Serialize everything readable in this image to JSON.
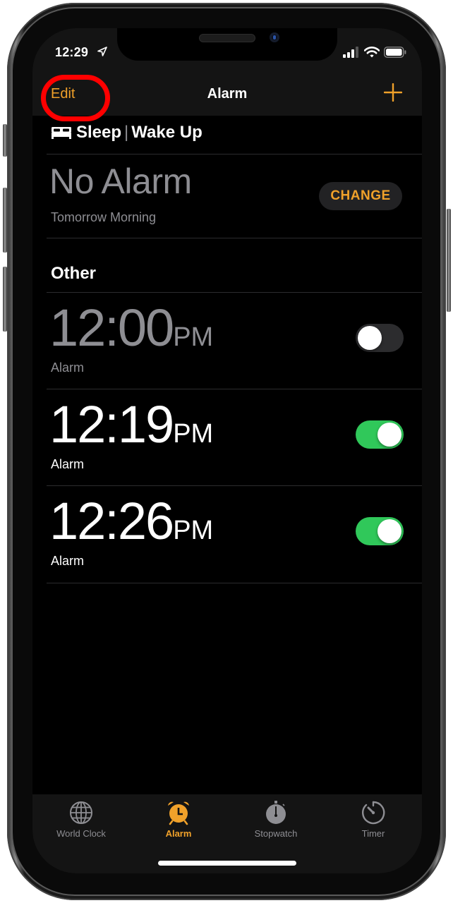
{
  "status_bar": {
    "time": "12:29",
    "icons": [
      "location-arrow-icon",
      "cellular-signal-icon",
      "wifi-icon",
      "battery-icon"
    ]
  },
  "nav": {
    "edit_label": "Edit",
    "title": "Alarm",
    "add_icon": "plus-icon",
    "highlight_color": "#ff0000"
  },
  "sleep_section": {
    "icon": "bed-icon",
    "title_left": "Sleep",
    "separator": "|",
    "title_right": "Wake Up",
    "alarm_text": "No Alarm",
    "subtitle": "Tomorrow Morning",
    "change_label": "CHANGE"
  },
  "other_section": {
    "title": "Other",
    "alarms": [
      {
        "time": "12:00",
        "ampm": "PM",
        "label": "Alarm",
        "enabled": false
      },
      {
        "time": "12:19",
        "ampm": "PM",
        "label": "Alarm",
        "enabled": true
      },
      {
        "time": "12:26",
        "ampm": "PM",
        "label": "Alarm",
        "enabled": true
      }
    ]
  },
  "tab_bar": {
    "tabs": [
      {
        "label": "World Clock",
        "icon": "globe-icon",
        "active": false
      },
      {
        "label": "Alarm",
        "icon": "alarm-clock-icon",
        "active": true
      },
      {
        "label": "Stopwatch",
        "icon": "stopwatch-icon",
        "active": false
      },
      {
        "label": "Timer",
        "icon": "timer-icon",
        "active": false
      }
    ]
  },
  "colors": {
    "accent": "#f0a12a",
    "toggle_on": "#30c85a",
    "toggle_off": "#2c2c2e",
    "secondary_text": "#8e8e93",
    "background": "#000000",
    "bar_background": "#141414"
  }
}
